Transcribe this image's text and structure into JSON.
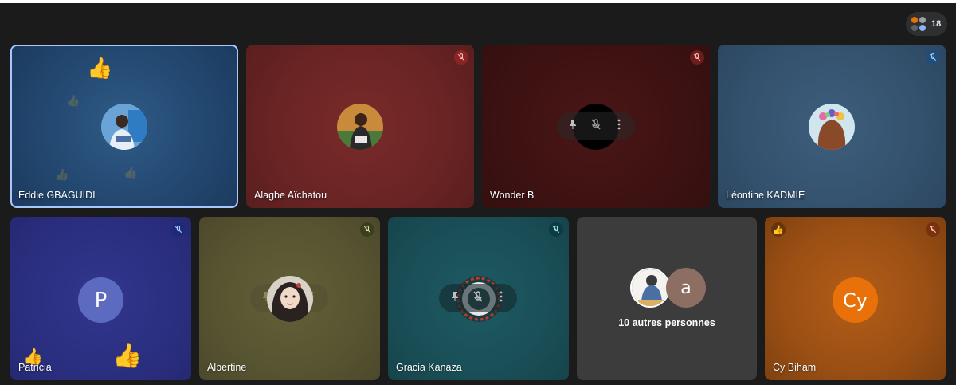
{
  "toolbar": {
    "participant_count": "18"
  },
  "participants": [
    {
      "name": "Eddie GBAGUIDI",
      "mic": "on",
      "reaction": "thumbs-up-icon"
    },
    {
      "name": "Alagbe Aïchatou",
      "mic": "muted"
    },
    {
      "name": "Wonder B",
      "mic": "muted"
    },
    {
      "name": "Léontine KADMIE",
      "mic": "muted"
    },
    {
      "name": "Patricia",
      "mic": "muted",
      "initial": "P",
      "reaction": "thumbs-up-icon"
    },
    {
      "name": "Albertine",
      "mic": "muted"
    },
    {
      "name": "Gracia Kanaza",
      "mic": "muted"
    },
    {
      "name": "Cy Biham",
      "mic": "muted",
      "initial": "Cy"
    }
  ],
  "others": {
    "label": "10 autres personnes",
    "avatar_initial": "a"
  },
  "colors": {
    "stage_bg": "#1b1b1b",
    "active_border": "#a8c7fa",
    "cy_avatar": "#e8710a",
    "patricia_avatar": "#5c6bc0"
  }
}
